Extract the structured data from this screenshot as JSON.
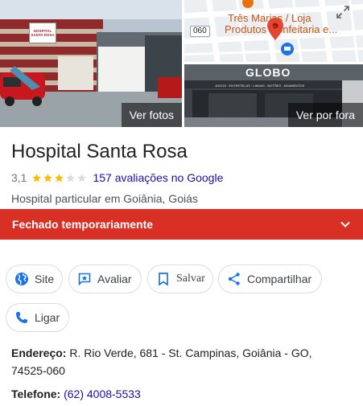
{
  "photos": {
    "see_photos_label": "Ver fotos",
    "see_outside_label": "Ver por fora",
    "map_place_line1": "Três Marias / Loja",
    "map_place_line2": "Produtos Confeitaria e...",
    "map_road_number": "060",
    "street_shop_sign": "GLOBO",
    "street_shop_subsign": "JOGOS · ENTRETELAS · LINHAS · BOTÕES · AVIAMENTOS",
    "hospital_sign_line1": "HOSPITAL",
    "hospital_sign_line2": "SANTA ROSA"
  },
  "place": {
    "name": "Hospital Santa Rosa",
    "rating": "3,1",
    "stars_filled": 3,
    "stars_total": 5,
    "reviews_label": "157 avaliações no Google",
    "category": "Hospital particular em Goiânia, Goiás"
  },
  "status": {
    "label": "Fechado temporariamente"
  },
  "actions": {
    "site": "Site",
    "review": "Avaliar",
    "save": "Salvar",
    "share": "Compartilhar",
    "call": "Ligar"
  },
  "info": {
    "address_label": "Endereço:",
    "address_line1": " R. Rio Verde, 681 - St. Campinas, Goiânia - GO,",
    "address_line2": "74525-060",
    "phone_label": "Telefone:",
    "phone_value": "(62) 4008-5533"
  },
  "colors": {
    "status_red": "#d93025",
    "link_blue": "#1a0dab",
    "star_gold": "#fbbc04",
    "icon_blue": "#1a73e8"
  },
  "icons": {
    "site": "globe-icon",
    "review": "rate-review-icon",
    "save": "bookmark-icon",
    "share": "share-icon",
    "call": "phone-icon",
    "status": "chevron-down-icon",
    "expand": "expand-icon",
    "map_pin": "map-pin-icon"
  }
}
